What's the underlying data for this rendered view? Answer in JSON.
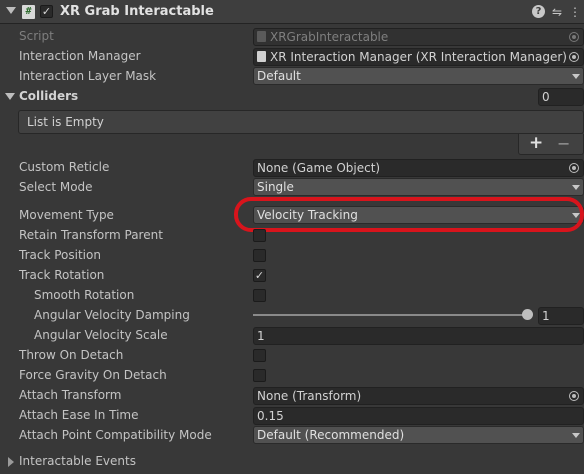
{
  "header": {
    "title": "XR Grab Interactable",
    "enabled": true
  },
  "fields": {
    "script": {
      "label": "Script",
      "value": "XRGrabInteractable"
    },
    "interaction_manager": {
      "label": "Interaction Manager",
      "value": "XR Interaction Manager (XR Interaction Manager)"
    },
    "interaction_layer_mask": {
      "label": "Interaction Layer Mask",
      "value": "Default"
    },
    "colliders": {
      "label": "Colliders",
      "count": "0",
      "empty_text": "List is Empty",
      "add": "+",
      "remove": "−"
    },
    "custom_reticle": {
      "label": "Custom Reticle",
      "value": "None (Game Object)"
    },
    "select_mode": {
      "label": "Select Mode",
      "value": "Single"
    },
    "movement_type": {
      "label": "Movement Type",
      "value": "Velocity Tracking"
    },
    "retain_transform_parent": {
      "label": "Retain Transform Parent",
      "checked": false
    },
    "track_position": {
      "label": "Track Position",
      "checked": false
    },
    "track_rotation": {
      "label": "Track Rotation",
      "checked": true
    },
    "smooth_rotation": {
      "label": "Smooth Rotation",
      "checked": false
    },
    "angular_velocity_damping": {
      "label": "Angular Velocity Damping",
      "value": "1",
      "slider_fraction": 1.0
    },
    "angular_velocity_scale": {
      "label": "Angular Velocity Scale",
      "value": "1"
    },
    "throw_on_detach": {
      "label": "Throw On Detach",
      "checked": false
    },
    "force_gravity_on_detach": {
      "label": "Force Gravity On Detach",
      "checked": false
    },
    "attach_transform": {
      "label": "Attach Transform",
      "value": "None (Transform)"
    },
    "attach_ease_in_time": {
      "label": "Attach Ease In Time",
      "value": "0.15"
    },
    "attach_point_compatibility_mode": {
      "label": "Attach Point Compatibility Mode",
      "value": "Default (Recommended)"
    },
    "interactable_events": {
      "label": "Interactable Events"
    }
  },
  "icons": {
    "header_fold": "triangle-down",
    "script": "script-hash-icon",
    "help": "help-icon",
    "presets": "sliders-icon",
    "menu": "kebab-icon",
    "check": "✓"
  },
  "colors": {
    "annotation": "#d8141c",
    "background": "#383838"
  }
}
